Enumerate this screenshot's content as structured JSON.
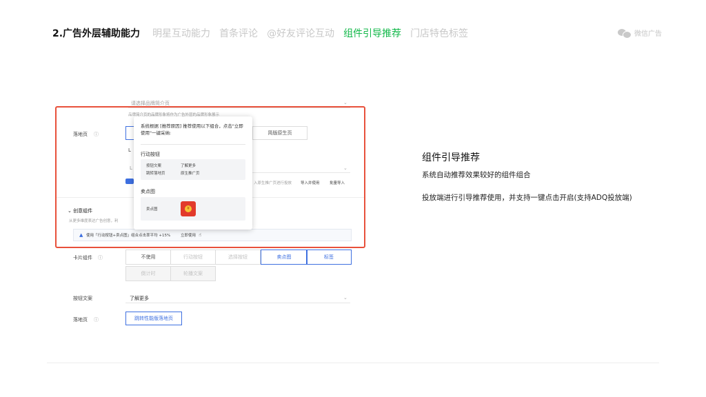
{
  "header": {
    "section_title": "2.广告外层辅助能力",
    "tabs": [
      {
        "label": "明星互动能力",
        "state": "inactive"
      },
      {
        "label": "首条评论",
        "state": "inactive"
      },
      {
        "label": "@好友评论互动",
        "state": "inactive"
      },
      {
        "label": "组件引导推荐",
        "state": "active"
      },
      {
        "label": "门店特色标签",
        "state": "inactive"
      }
    ],
    "brand": "微信广告",
    "brand_icon": "wechat-icon"
  },
  "screenshot": {
    "top_select": "请选择品牌简介页",
    "top_hint": "品牌简介页的品牌形象将作为广告外层的品牌形象展示",
    "landing_label": "落地页",
    "landing_option": "简版原生页",
    "landing_letter": "L",
    "landing_import_text": "入原生推广页进行投放",
    "import_link": "导入并使用",
    "batch_link": "批量导入",
    "creative_title": "创意组件",
    "creative_hint": "从更多维度表达广告创意，利",
    "recommend_banner": "使用「行动按钮+卖点图」组合点击率平均 +15%",
    "use_now": "立即使用",
    "card_label": "卡片组件",
    "card_options": [
      "不使用",
      "行动按钮",
      "选择按钮",
      "卖点图",
      "标签"
    ],
    "card_options_row2": [
      "倒计时",
      "轮播文案"
    ],
    "button_copy_label": "按钮文案",
    "button_copy_value": "了解更多",
    "landing2_label": "落地页",
    "landing2_value": "跳转性能版落地页",
    "popup": {
      "message": "系统根据 [推荐原因] 推荐使用以下组合，点击\"立即使用\"一键采纳:",
      "action_section": "行动按钮",
      "rows": [
        {
          "key": "按钮文案",
          "value": "了解更多"
        },
        {
          "key": "跳转落地页",
          "value": "原生推广页"
        }
      ],
      "selling_section": "卖点图",
      "selling_key": "卖点图"
    }
  },
  "info": {
    "title": "组件引导推荐",
    "line1": "系统自动推荐效果较好的组件组合",
    "line2": "投放端进行引导推荐使用，并支持一键点击开启(支持ADQ投放端)"
  },
  "colors": {
    "accent_green": "#12b849",
    "highlight_red": "#e8503a",
    "link_blue": "#3d6fe0"
  }
}
